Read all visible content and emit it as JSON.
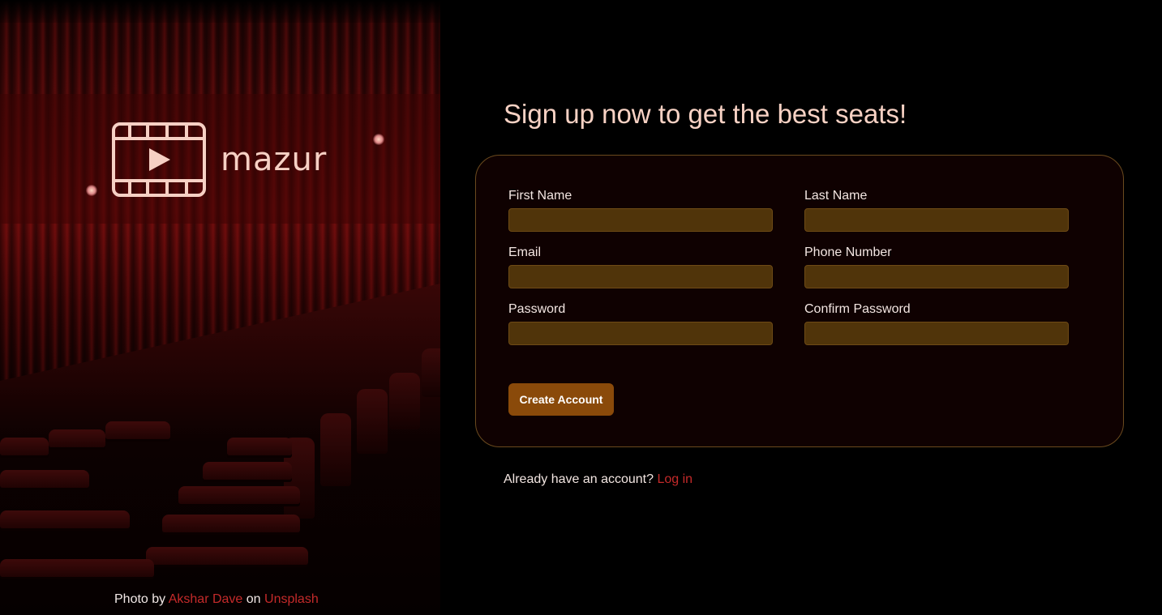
{
  "brand": {
    "name": "mazur",
    "logo_icon": "film-play-icon",
    "color": "#f6d0c4"
  },
  "hero": {
    "credit_prefix": "Photo by",
    "credit_author": "Akshar Dave",
    "credit_middle": "on",
    "credit_source": "Unsplash"
  },
  "signup": {
    "headline": "Sign up now to get the best seats!",
    "fields": {
      "first_name": {
        "label": "First Name",
        "value": ""
      },
      "last_name": {
        "label": "Last Name",
        "value": ""
      },
      "email": {
        "label": "Email",
        "value": ""
      },
      "phone": {
        "label": "Phone Number",
        "value": ""
      },
      "password": {
        "label": "Password",
        "value": ""
      },
      "confirm_password": {
        "label": "Confirm Password",
        "value": ""
      }
    },
    "submit_label": "Create Account"
  },
  "login_prompt": {
    "text": "Already have an account?",
    "link_label": "Log in"
  },
  "colors": {
    "accent": "#8a4a0a",
    "input_bg": "#50340a",
    "link": "#c42a2a",
    "headline": "#f8d2c4",
    "card_border": "#6a4a1e"
  }
}
